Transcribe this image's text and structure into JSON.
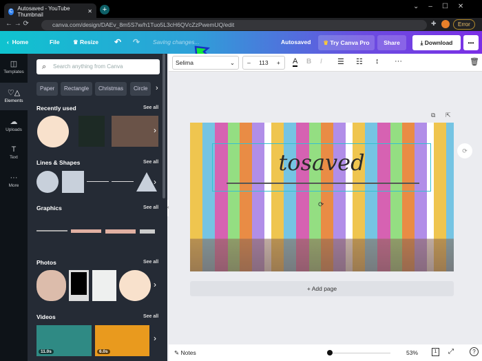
{
  "browser": {
    "tab_title": "Autosaved - YouTube Thumbnail",
    "url": "canva.com/design/DAEv_8m5S7w/h1Tuo5L3cH6QVcZzPwemUQ/edit",
    "profile_status": "Error"
  },
  "header": {
    "home": "Home",
    "file": "File",
    "resize": "Resize",
    "saving": "Saving changes...",
    "autosaved": "Autosaved",
    "try_pro": "Try Canva Pro",
    "share": "Share",
    "download": "Download",
    "accent_from": "#0fc3cf",
    "accent_to": "#7b2fe6"
  },
  "rail": [
    {
      "label": "Templates",
      "icon": "templates-icon"
    },
    {
      "label": "Elements",
      "icon": "elements-icon"
    },
    {
      "label": "Uploads",
      "icon": "upload-icon"
    },
    {
      "label": "Text",
      "icon": "text-icon"
    },
    {
      "label": "More",
      "icon": "more-icon"
    }
  ],
  "panel": {
    "search_placeholder": "Search anything from Canva",
    "chips": [
      "Paper",
      "Rectangle",
      "Christmas",
      "Circle"
    ],
    "sections": [
      {
        "title": "Recently used",
        "see_all": "See all"
      },
      {
        "title": "Lines & Shapes",
        "see_all": "See all"
      },
      {
        "title": "Graphics",
        "see_all": "See all"
      },
      {
        "title": "Photos",
        "see_all": "See all"
      },
      {
        "title": "Videos",
        "see_all": "See all"
      }
    ],
    "videos": [
      "11.0s",
      "6.0s"
    ]
  },
  "toolbar": {
    "font": "Selima",
    "font_size": "113"
  },
  "canvas": {
    "text": "tosaved",
    "add_page": "+ Add page"
  },
  "bottom": {
    "notes": "Notes",
    "zoom": "53%",
    "page": "1",
    "zoom_fraction": 0.1
  }
}
